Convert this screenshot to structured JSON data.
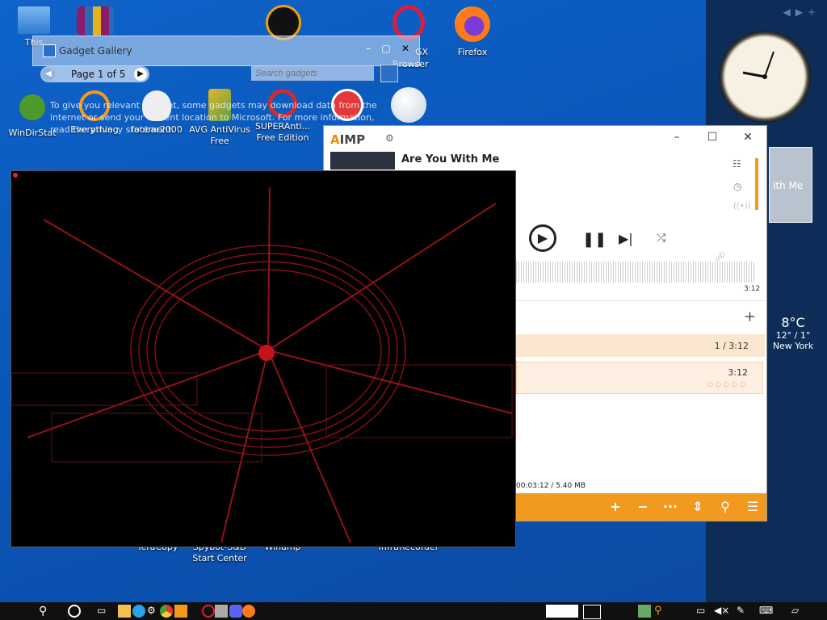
{
  "desktop": {
    "icons": [
      {
        "label": "This PC",
        "name": "this-pc-icon"
      },
      {
        "label": "WinRAR",
        "name": "winrar-icon"
      },
      {
        "label": "AIMP",
        "name": "aimp-desktop-icon"
      },
      {
        "label": "Opera GX Browser",
        "name": "opera-gx-icon"
      },
      {
        "label": "Firefox",
        "name": "firefox-icon"
      },
      {
        "label": "WinDirStat",
        "name": "windirstat-icon"
      },
      {
        "label": "Everything",
        "name": "everything-icon"
      },
      {
        "label": "foobar2000",
        "name": "foobar2000-icon"
      },
      {
        "label": "AVG AntiVirus Free",
        "name": "avg-icon"
      },
      {
        "label": "SUPERAntiSpyware Free Edition",
        "name": "superantispyware-icon"
      },
      {
        "label": "TeraCopy",
        "name": "teracopy-icon"
      },
      {
        "label": "Spybot-S&D Start Center",
        "name": "spybot-icon"
      },
      {
        "label": "Winamp",
        "name": "winamp-icon"
      },
      {
        "label": "InfraRecorder",
        "name": "infrarecorder-icon"
      }
    ],
    "icon_labels_shown": {
      "this_pc": "This",
      "opera_partial": "GX",
      "opera_browser": "Browser",
      "firefox": "Firefox",
      "windirstat": "WinDirStat",
      "everything": "Everything",
      "foobar": "foobar2000",
      "avg_line1": "AVG AntiVirus",
      "avg_line2": "Free",
      "super_line1": "SUPERAnti...",
      "super_line2": "Free Edition",
      "teracopy": "TeraCopy",
      "spybot_line1": "Spybot-S&D",
      "spybot_line2": "Start Center",
      "winamp": "Winamp",
      "infrarecorder": "InfraRecorder"
    }
  },
  "gadget_gallery": {
    "title": "Gadget Gallery",
    "page_label": "Page 1 of 5",
    "search_placeholder": "Search gadgets",
    "notice": "To give you relevant content, some gadgets may download data from the internet or send your current location to Microsoft. For more information, read the privacy statement."
  },
  "sidebar": {
    "clock_label": "Clock",
    "now_playing_partial": "ith Me",
    "weather": {
      "temp": "8°C",
      "range": "12° / 1°",
      "city": "New York"
    }
  },
  "aimp": {
    "logo_a": "A",
    "logo_rest": "IMP",
    "track_title": "Are You With Me",
    "elapsed_total": "3:12",
    "playlist_summary": "1 / 3:12",
    "playlist_item_time": "3:12",
    "footer_info": "00:03:12 / 5.40 MB",
    "progress_fraction": 0.0
  },
  "taskbar": {
    "search_icon": "search-icon",
    "cortana_icon": "cortana-icon",
    "taskview_icon": "task-view-icon"
  },
  "colors": {
    "desktop_bg": "#0c57bb",
    "sidebar_bg": "#0d2d58",
    "aimp_accent": "#f29a1f",
    "visualizer_red": "#d0141b"
  }
}
